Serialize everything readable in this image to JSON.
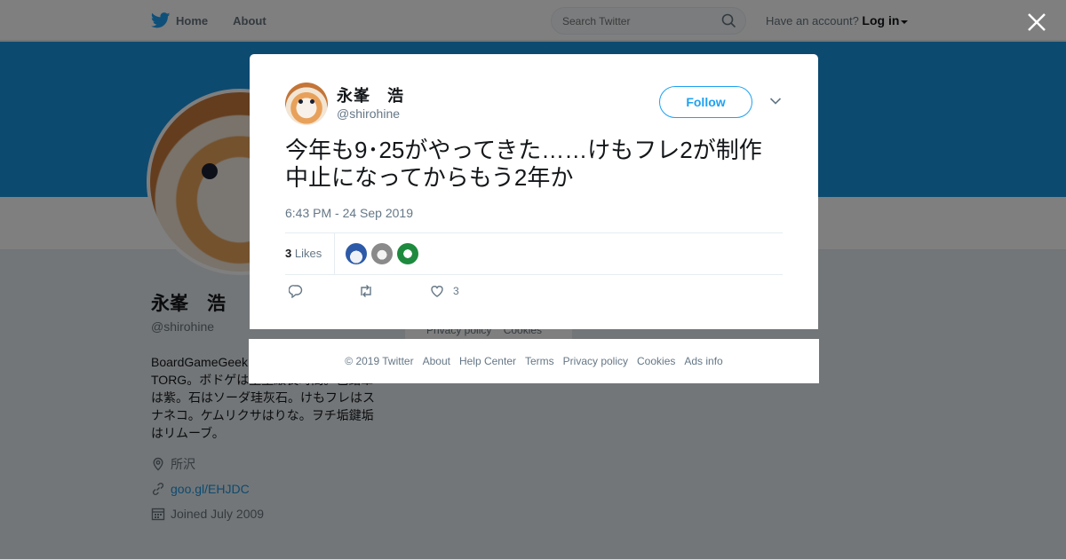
{
  "topbar": {
    "home_label": "Home",
    "about_label": "About",
    "search_placeholder": "Search Twitter",
    "account_prompt": "Have an account?",
    "login_label": "Log in"
  },
  "profile": {
    "name": "永峯　浩",
    "handle": "@shirohine",
    "bio": "BoardGameGeek ます（ID:nagamin TORG。ボドゲは重量級長時間。色鉛筆は紫。石はソーダ珪灰石。けもフレはスナネコ。ケムリクサはりな。ヲチ垢鍵垢はリムーブ。",
    "location": "所沢",
    "link": "goo.gl/EHJDC",
    "joined": "Joined July 2009"
  },
  "behind_footer": {
    "privacy": "Privacy policy",
    "cookies": "Cookies"
  },
  "tweet": {
    "author_name": "永峯　浩",
    "author_handle": "@shirohine",
    "follow_label": "Follow",
    "text": "今年も9･25がやってきた……けもフレ2が制作中止になってからもう2年か",
    "timestamp": "6:43 PM - 24 Sep 2019",
    "likes_count": "3",
    "likes_label": "Likes",
    "like_action_count": "3"
  },
  "footer": {
    "copyright": "© 2019 Twitter",
    "about": "About",
    "help": "Help Center",
    "terms": "Terms",
    "privacy": "Privacy policy",
    "cookies": "Cookies",
    "ads": "Ads info"
  },
  "colors": {
    "brand": "#1da1f2",
    "banner": "#1b95e0",
    "muted_text": "#657786"
  },
  "icons": [
    "twitter-bird-icon",
    "home-icon",
    "search-icon",
    "close-icon",
    "chevron-down-icon",
    "reply-icon",
    "retweet-icon",
    "heart-icon",
    "location-icon",
    "link-icon",
    "calendar-icon"
  ]
}
